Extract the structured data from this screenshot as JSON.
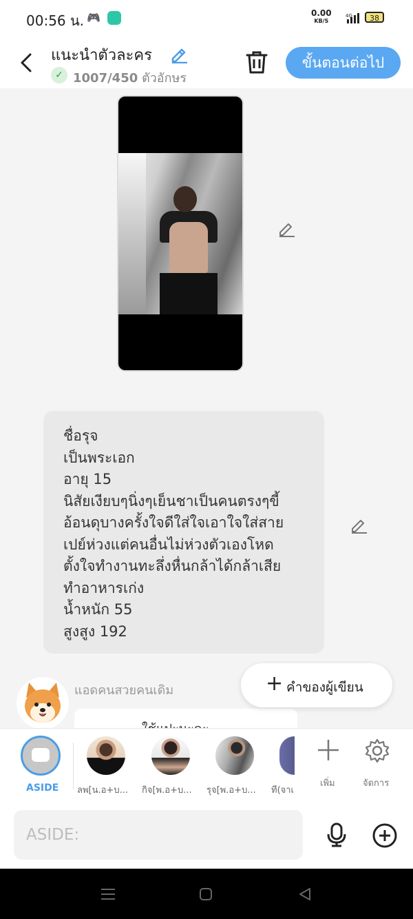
{
  "status_bar": {
    "time": "00:56 น.",
    "net_speed": "0.00",
    "net_unit": "KB/S",
    "network_type": "4G",
    "battery": "38"
  },
  "header": {
    "title": "แนะนำตัวละคร",
    "char_count": "1007/450",
    "char_unit": "ตัวอักษร",
    "next_button": "ขั้นตอนต่อไป"
  },
  "content": {
    "description_lines": [
      "ชื่อรุจ",
      "เป็นพระเอก",
      "อายุ 15",
      "นิสัยเงียบๆนิ่งๆเย็นชาเป็นคนตรงๆขี้",
      "อ้อนดุบางครั้งใจดีใส่ใจเอาใจใส่สาย",
      "เปย์ห่วงแต่คนอื่นไม่ห่วงตัวเองโหด",
      "ตั้งใจทำงานทะลึ่งหื่นกล้าได้กล้าเสีย",
      "ทำอาหารเก่ง",
      "น้ำหนัก 55",
      "สูงสูง 192"
    ]
  },
  "author": {
    "name": "แอดคนสวยคนเดิม",
    "reply_preview": "ใช้แปะนะคะ",
    "author_note_button": "คำของผู้เขียน"
  },
  "character_bar": {
    "aside_label": "ASIDE",
    "characters": [
      {
        "name": "ลพ[น.อ+บ..."
      },
      {
        "name": "กิจ[พ.อ+บ..."
      },
      {
        "name": "รุจ[พ.อ+บ..."
      },
      {
        "name": "ที(จาเ"
      }
    ],
    "add_label": "เพิ่ม",
    "manage_label": "จัดการ"
  },
  "input": {
    "placeholder": "ASIDE:"
  },
  "colors": {
    "accent": "#5aa8f2",
    "bubble": "#e9e9e9"
  }
}
